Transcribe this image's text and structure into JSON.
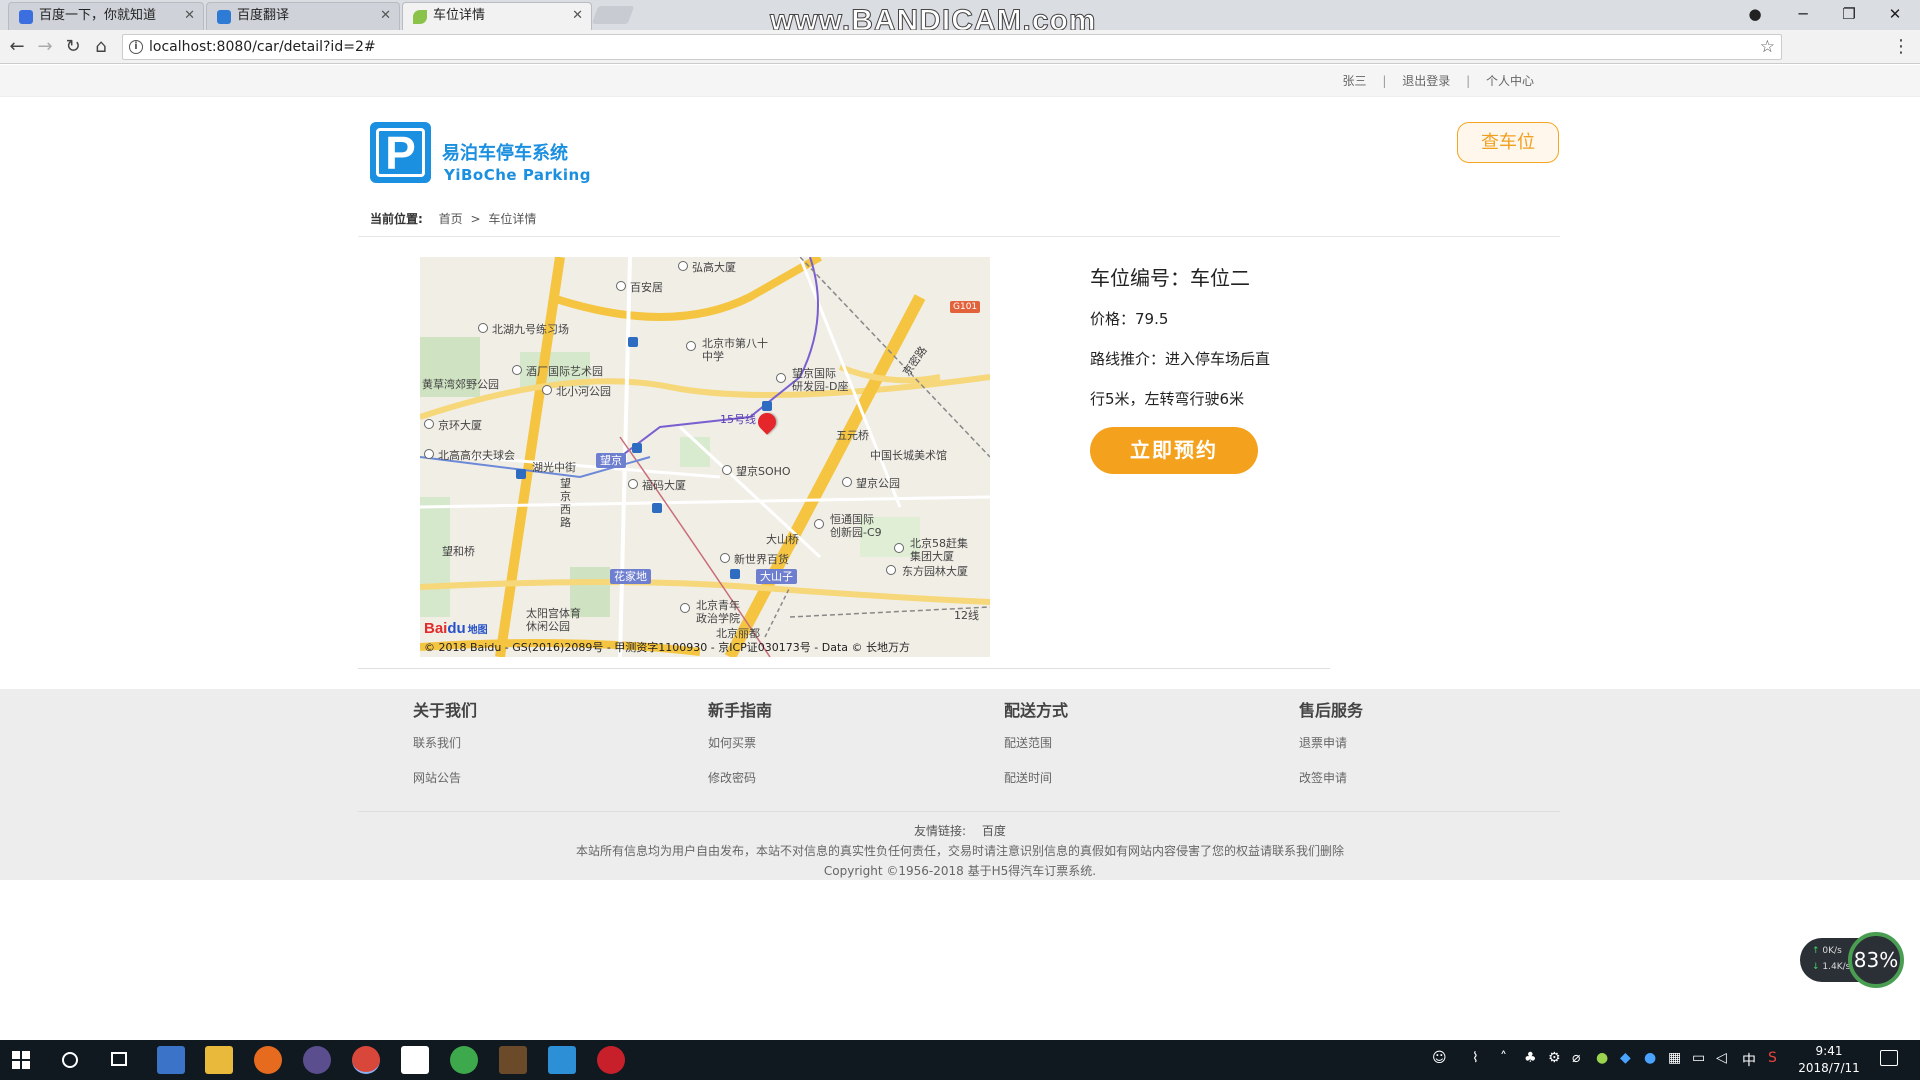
{
  "browser": {
    "tabs": [
      {
        "title": "百度一下，你就知道",
        "active": false
      },
      {
        "title": "百度翻译",
        "active": false
      },
      {
        "title": "车位详情",
        "active": true
      }
    ],
    "watermark": "www.BANDICAM.com",
    "url": "localhost:8080/car/detail?id=2#"
  },
  "topbar": {
    "user": "张三",
    "logout": "退出登录",
    "profile": "个人中心"
  },
  "logo": {
    "mark": "P",
    "name_cn": "易泊车停车系统",
    "name_en": "YiBoChe  Parking"
  },
  "header": {
    "find_spot": "查车位"
  },
  "breadcrumb": {
    "label": "当前位置:",
    "home": "首页",
    "separator": ">",
    "current": "车位详情"
  },
  "map": {
    "labels": {
      "hongshang": "弘高大厦",
      "baian": "百安居",
      "beihu": "北湖九号练习场",
      "beijing80": "北京市第八十",
      "beijing80b": "中学",
      "jiuchang": "酒厂国际艺术园",
      "huangcao": "黄草湾郊野公园",
      "beixiaohe": "北小河公园",
      "wangjingguoji": "望京国际",
      "yanfayuan": "研发园-D座",
      "jinghuan": "京环大厦",
      "line15": "15号线",
      "wuyuanqiao": "五元桥",
      "beigaoerfu": "北高高尔夫球会",
      "huguangzhongjie": "湖光中街",
      "wangjing": "望京",
      "wangjingsoho": "望京SOHO",
      "changcheng": "中国长城美术馆",
      "fuma": "福码大厦",
      "wangjinglu": "望京西路",
      "wangjinggongyuan": "望京公园",
      "hengtong": "恒通国际",
      "chuangxin": "创新园-C9",
      "dashanqiao": "大山桥",
      "bj58": "北京58赶集",
      "jituan": "集团大厦",
      "wangheqiao": "望和桥",
      "xinshijie": "新世界百货",
      "dongfang": "东方园林大厦",
      "huajiadi": "花家地",
      "dashanzi": "大山子",
      "taiyanggong": "太阳宫体育",
      "xiuxian": "休闲公园",
      "qingnian": "北京青年",
      "zhengzhi": "政治学院",
      "lidu": "北京丽都",
      "g101": "G101",
      "jingmi": "京密路",
      "ring12": "12线"
    },
    "copyright": "© 2018 Baidu - GS(2016)2089号 - 甲测资字1100930 - 京ICP证030173号 - Data © 长地万方",
    "logo_bai": "Bai",
    "logo_du": "du",
    "logo_ditu": "地图"
  },
  "detail": {
    "spot_number": "车位编号：车位二",
    "price": "价格：79.5",
    "route_line1": "路线推介：进入停车场后直",
    "route_line2": "行5米，左转弯行驶6米",
    "reserve": "立即预约"
  },
  "footer": {
    "columns": [
      {
        "title": "关于我们",
        "links": [
          "联系我们",
          "网站公告"
        ]
      },
      {
        "title": "新手指南",
        "links": [
          "如何买票",
          "修改密码"
        ]
      },
      {
        "title": "配送方式",
        "links": [
          "配送范围",
          "配送时间"
        ]
      },
      {
        "title": "售后服务",
        "links": [
          "退票申请",
          "改签申请"
        ]
      }
    ],
    "friend_label": "友情链接:",
    "friend_link": "百度",
    "disclaimer": "本站所有信息均为用户自由发布，本站不对信息的真实性负任何责任，交易时请注意识别信息的真假如有网站内容侵害了您的权益请联系我们删除",
    "copyright": "Copyright ©1956-2018 基于H5得汽车订票系统."
  },
  "net_widget": {
    "upload": "0K/s",
    "download": "1.4K/s",
    "percent": "83%"
  },
  "taskbar": {
    "time": "9:41",
    "date": "2018/7/11",
    "ime": "中"
  },
  "colors": {
    "brand_blue": "#1b8fe0",
    "accent_orange": "#f4a21d"
  }
}
